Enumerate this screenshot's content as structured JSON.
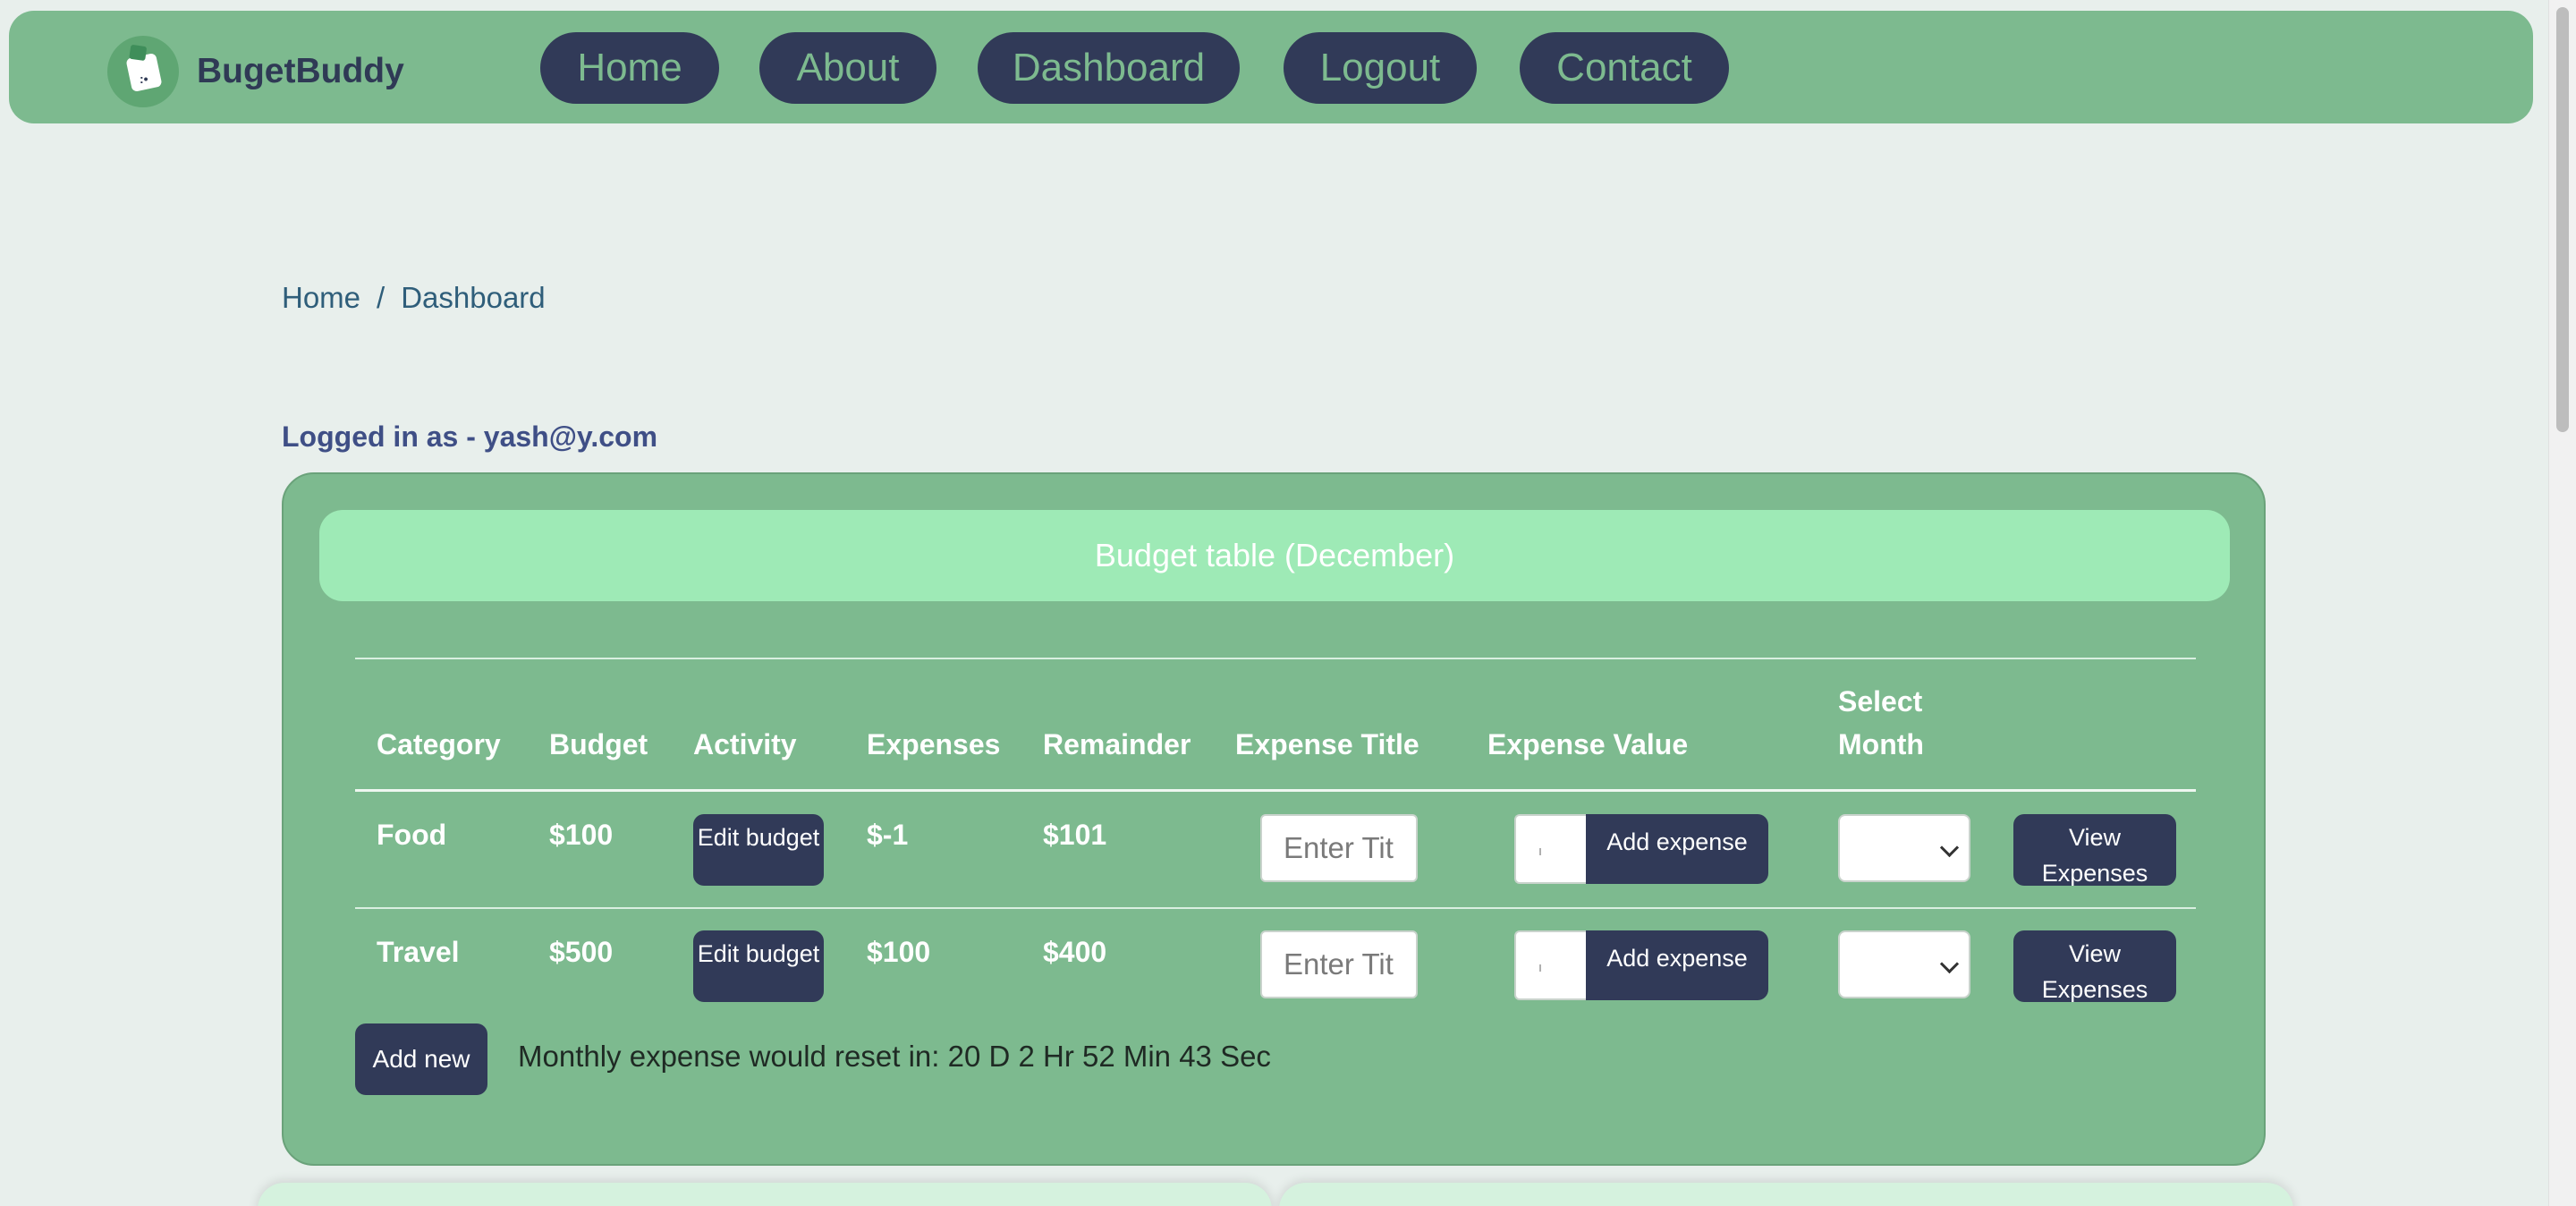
{
  "brand": {
    "name": "BugetBuddy"
  },
  "nav": {
    "home": "Home",
    "about": "About",
    "dashboard": "Dashboard",
    "logout": "Logout",
    "contact": "Contact"
  },
  "breadcrumb": {
    "home": "Home",
    "separator": "/",
    "current": "Dashboard"
  },
  "user": {
    "logged_in_text": "Logged in as - yash@y.com"
  },
  "budget_table": {
    "title": "Budget table (December)",
    "headers": {
      "category": "Category",
      "budget": "Budget",
      "activity": "Activity",
      "expenses": "Expenses",
      "remainder": "Remainder",
      "expense_title": "Expense Title",
      "expense_value": "Expense Value",
      "select_month_1": "Select",
      "select_month_2": "Month"
    },
    "rows": [
      {
        "category": "Food",
        "budget": "$100",
        "edit_label": "Edit budget",
        "expenses": "$-1",
        "remainder": "$101",
        "title_placeholder": "Enter Tit",
        "add_label": "Add expense",
        "view_label": "View Expenses"
      },
      {
        "category": "Travel",
        "budget": "$500",
        "edit_label": "Edit budget",
        "expenses": "$100",
        "remainder": "$400",
        "title_placeholder": "Enter Tit",
        "add_label": "Add expense",
        "view_label": "View Expenses"
      }
    ],
    "add_new_label": "Add new",
    "reset_text": "Monthly expense would reset in: 20 D 2 Hr 52 Min 43 Sec"
  },
  "colors": {
    "page_bg": "#e8efec",
    "nav_bg": "#7dba8f",
    "dark_button": "#313a58",
    "title_bar": "#9eeab6"
  }
}
